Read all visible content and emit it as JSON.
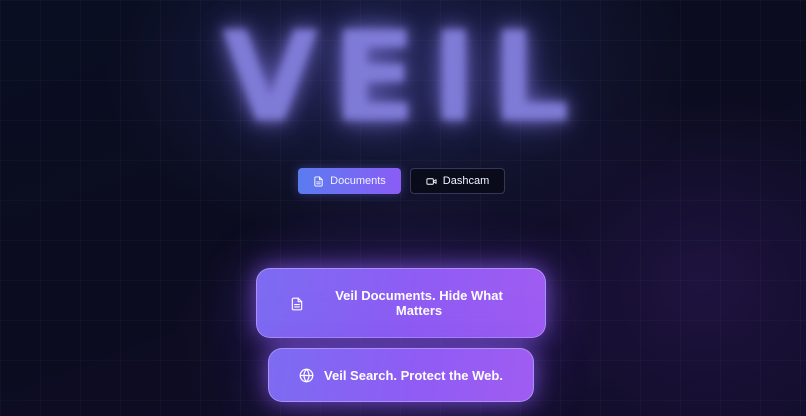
{
  "hero": {
    "title": "VEIL"
  },
  "mode_toggle": {
    "documents_label": "Documents",
    "dashcam_label": "Dashcam",
    "active": "Documents"
  },
  "feature_cards": [
    {
      "label": "Veil Documents. Hide What Matters",
      "icon": "document-icon"
    },
    {
      "label": "Veil Search. Protect the Web.",
      "icon": "globe-icon"
    }
  ],
  "colors": {
    "background": "#0b0c1f",
    "accent_start": "#5a7cf0",
    "accent_end": "#8b5cf6",
    "card_purple": "#8f5cf4",
    "title_glow": "#8a86e8"
  }
}
